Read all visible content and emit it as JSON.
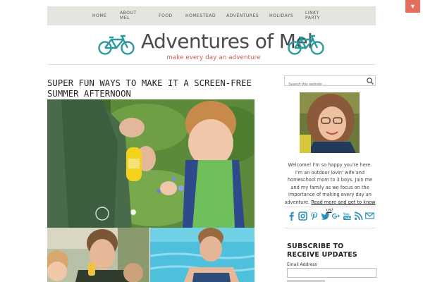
{
  "nav": {
    "items": [
      {
        "label": "HOME"
      },
      {
        "label": "ABOUT\nMEL"
      },
      {
        "label": "FOOD"
      },
      {
        "label": "HOMESTEAD"
      },
      {
        "label": "ADVENTURES"
      },
      {
        "label": "HOLIDAYS"
      },
      {
        "label": "LINKY\nPARTY"
      }
    ],
    "corner_icon": "▼"
  },
  "header": {
    "title": "Adventures of Mel",
    "tagline": "make every day an adventure",
    "logo_icon": "bicycle-icon"
  },
  "post": {
    "title": "SUPER FUN WAYS TO MAKE IT A SCREEN-FREE SUMMER AFTERNOON"
  },
  "sidebar": {
    "search_placeholder": "Search this website …",
    "welcome_text": "Welcome! I'm so happy you're here. I'm an outdoor lovin' wife and homeschool mom to 3 boys. Join me and my family as we focus on the importance of making every day an adventure. ",
    "welcome_link": "Read more and get to know us",
    "welcome_end": "!",
    "social_icons": [
      "facebook-icon",
      "instagram-icon",
      "pinterest-icon",
      "twitter-icon",
      "google-plus-icon",
      "youtube-icon",
      "rss-icon",
      "email-icon"
    ],
    "subscribe_heading": "SUBSCRIBE TO RECEIVE UPDATES",
    "email_label": "Email Address"
  },
  "colors": {
    "accent": "#d35a4a",
    "nav_bg": "#e5e5e0",
    "social_blue": "#2a8fb8",
    "bike_teal": "#2e9aa0"
  }
}
